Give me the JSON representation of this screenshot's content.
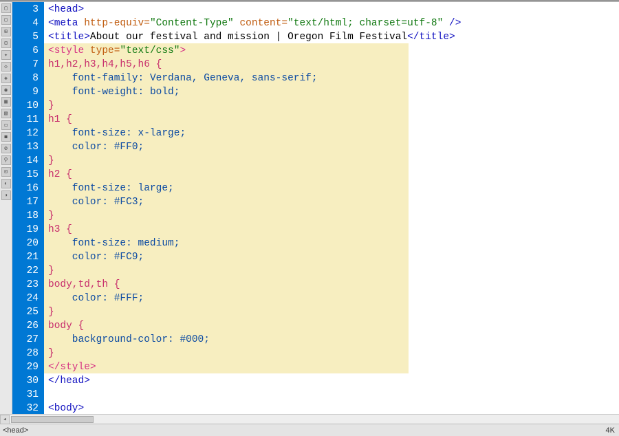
{
  "gutter": {
    "start": 3,
    "end": 32
  },
  "toolbar_icons": [
    "▢",
    "▢",
    "⊞",
    "⊟",
    "✦",
    "◇",
    "◈",
    "◉",
    "▦",
    "▧",
    "◻",
    "◼",
    "⚙",
    "⚲",
    "⊡",
    "◐",
    "◑"
  ],
  "lines": [
    [
      {
        "t": "<head>",
        "c": "tag"
      }
    ],
    [
      {
        "t": "<meta ",
        "c": "tag"
      },
      {
        "t": "http-equiv=",
        "c": "attr"
      },
      {
        "t": "\"Content-Type\"",
        "c": "string"
      },
      {
        "t": " content=",
        "c": "attr"
      },
      {
        "t": "\"text/html; charset=utf-8\"",
        "c": "string"
      },
      {
        "t": " />",
        "c": "tag"
      }
    ],
    [
      {
        "t": "<title>",
        "c": "tag"
      },
      {
        "t": "About our festival and mission | Oregon Film Festival",
        "c": "text"
      },
      {
        "t": "</title>",
        "c": "tag"
      }
    ],
    [
      {
        "t": "<style ",
        "c": "pink"
      },
      {
        "t": "type=",
        "c": "attr"
      },
      {
        "t": "\"text/css\"",
        "c": "string"
      },
      {
        "t": ">",
        "c": "pink"
      }
    ],
    [
      {
        "t": "h1,h2,h3,h4,h5,h6 ",
        "c": "sel"
      },
      {
        "t": "{",
        "c": "brace"
      }
    ],
    [
      {
        "t": "    font-family: ",
        "c": "prop"
      },
      {
        "t": "Verdana, Geneva, sans-serif",
        "c": "prop"
      },
      {
        "t": ";",
        "c": "prop"
      }
    ],
    [
      {
        "t": "    font-weight: ",
        "c": "prop"
      },
      {
        "t": "bold",
        "c": "prop"
      },
      {
        "t": ";",
        "c": "prop"
      }
    ],
    [
      {
        "t": "}",
        "c": "brace"
      }
    ],
    [
      {
        "t": "h1 ",
        "c": "sel"
      },
      {
        "t": "{",
        "c": "brace"
      }
    ],
    [
      {
        "t": "    font-size: ",
        "c": "prop"
      },
      {
        "t": "x-large",
        "c": "prop"
      },
      {
        "t": ";",
        "c": "prop"
      }
    ],
    [
      {
        "t": "    color: ",
        "c": "prop"
      },
      {
        "t": "#FF0",
        "c": "prop"
      },
      {
        "t": ";",
        "c": "prop"
      }
    ],
    [
      {
        "t": "}",
        "c": "brace"
      }
    ],
    [
      {
        "t": "h2 ",
        "c": "sel"
      },
      {
        "t": "{",
        "c": "brace"
      }
    ],
    [
      {
        "t": "    font-size: ",
        "c": "prop"
      },
      {
        "t": "large",
        "c": "prop"
      },
      {
        "t": ";",
        "c": "prop"
      }
    ],
    [
      {
        "t": "    color: ",
        "c": "prop"
      },
      {
        "t": "#FC3",
        "c": "prop"
      },
      {
        "t": ";",
        "c": "prop"
      }
    ],
    [
      {
        "t": "}",
        "c": "brace"
      }
    ],
    [
      {
        "t": "h3 ",
        "c": "sel"
      },
      {
        "t": "{",
        "c": "brace"
      }
    ],
    [
      {
        "t": "    font-size: ",
        "c": "prop"
      },
      {
        "t": "medium",
        "c": "prop"
      },
      {
        "t": ";",
        "c": "prop"
      }
    ],
    [
      {
        "t": "    color: ",
        "c": "prop"
      },
      {
        "t": "#FC9",
        "c": "prop"
      },
      {
        "t": ";",
        "c": "prop"
      }
    ],
    [
      {
        "t": "}",
        "c": "brace"
      }
    ],
    [
      {
        "t": "body,td,th ",
        "c": "sel"
      },
      {
        "t": "{",
        "c": "brace"
      }
    ],
    [
      {
        "t": "    color: ",
        "c": "prop"
      },
      {
        "t": "#FFF",
        "c": "prop"
      },
      {
        "t": ";",
        "c": "prop"
      }
    ],
    [
      {
        "t": "}",
        "c": "brace"
      }
    ],
    [
      {
        "t": "body ",
        "c": "sel"
      },
      {
        "t": "{",
        "c": "brace"
      }
    ],
    [
      {
        "t": "    background-color: ",
        "c": "prop"
      },
      {
        "t": "#000",
        "c": "prop"
      },
      {
        "t": ";",
        "c": "prop"
      }
    ],
    [
      {
        "t": "}",
        "c": "brace"
      }
    ],
    [
      {
        "t": "</style>",
        "c": "pink"
      }
    ],
    [
      {
        "t": "</head>",
        "c": "tag"
      }
    ],
    [
      {
        "t": "",
        "c": "text"
      }
    ],
    [
      {
        "t": "<body>",
        "c": "tag"
      }
    ]
  ],
  "status": {
    "path": "<head>",
    "right": "4K"
  }
}
